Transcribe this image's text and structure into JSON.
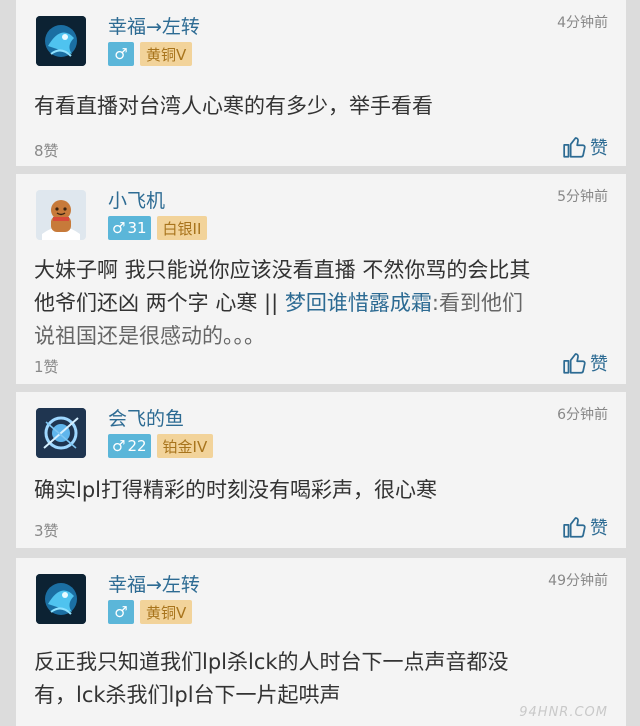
{
  "comments": [
    {
      "username": "幸福→左转",
      "time": "4分钟前",
      "gender_symbol": "♂",
      "level": "",
      "rank": "黄铜V",
      "content_lines": [
        "有看直播对台湾人心寒的有多少，举手看看"
      ],
      "likes": "8赞",
      "like_label": "赞"
    },
    {
      "username": "小飞机",
      "time": "5分钟前",
      "gender_symbol": "♂",
      "level": "31",
      "rank": "白银II",
      "content_lines": [
        "大妹子啊 我只能说你应该没看直播  不然你骂的会比其",
        "他爷们还凶  两个字  心寒 "
      ],
      "quote_mark": "||",
      "quote_user": "梦回谁惜露成霜",
      "quote_text": ":看到他们",
      "quote_line2": "说祖国还是很感动的。。。",
      "likes": "1赞",
      "like_label": "赞"
    },
    {
      "username": "会飞的鱼",
      "time": "6分钟前",
      "gender_symbol": "♂",
      "level": "22",
      "rank": "铂金IV",
      "content_lines": [
        "确实lpl打得精彩的时刻没有喝彩声，很心寒"
      ],
      "likes": "3赞",
      "like_label": "赞"
    },
    {
      "username": "幸福→左转",
      "time": "49分钟前",
      "gender_symbol": "♂",
      "level": "",
      "rank": "黄铜V",
      "content_lines": [
        "反正我只知道我们lpl杀lck的人时台下一点声音都没",
        "有，lck杀我们lpl台下一片起哄声"
      ],
      "likes": "",
      "like_label": ""
    }
  ],
  "watermark": "94HNR.COM",
  "colors": {
    "background": "#dcdcdc",
    "card": "#f4f4f4",
    "username": "#2d6b93",
    "gender_badge": "#5bb6d9",
    "rank_badge": "#f2d39a",
    "rank_text": "#a8741c"
  },
  "icons": [
    "avatar-dragon",
    "avatar-gingerbread",
    "avatar-blue-orb",
    "thumbs-up-icon"
  ]
}
